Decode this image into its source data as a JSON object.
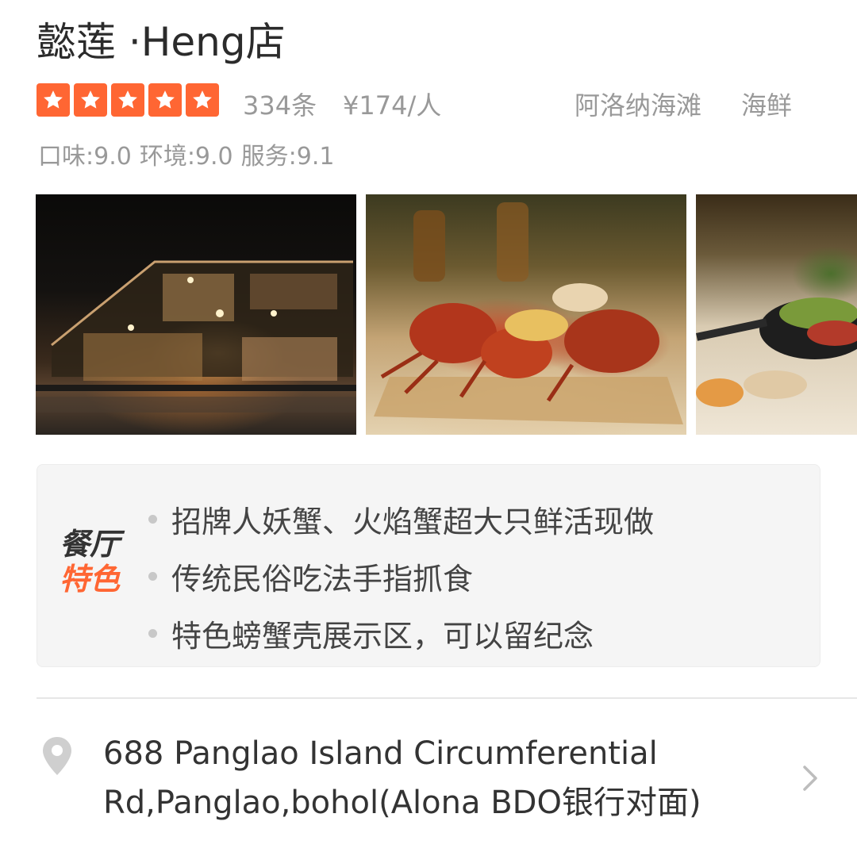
{
  "shop": {
    "name": "懿莲 ·Heng店",
    "rating_stars": 5,
    "review_count": "334条",
    "price_per_person": "¥174/人",
    "area": "阿洛纳海滩",
    "category": "海鲜",
    "scores": {
      "taste": "口味:9.0",
      "environment": "环境:9.0",
      "service": "服务:9.1"
    }
  },
  "features": {
    "tag_line1": "餐厅",
    "tag_line2": "特色",
    "items": [
      "招牌人妖蟹、火焰蟹超大只鲜活现做",
      "传统民俗吃法手指抓食",
      "特色螃蟹壳展示区，可以留纪念"
    ]
  },
  "address": {
    "text": "688 Panglao Island Circumferential Rd,Panglao,bohol(Alona BDO银行对面)"
  },
  "colors": {
    "accent": "#ff6633",
    "muted_text": "#999999",
    "feature_bg": "#f5f5f5"
  },
  "icons": {
    "star": "star-icon",
    "location": "location-pin-icon",
    "chevron": "chevron-right-icon"
  }
}
